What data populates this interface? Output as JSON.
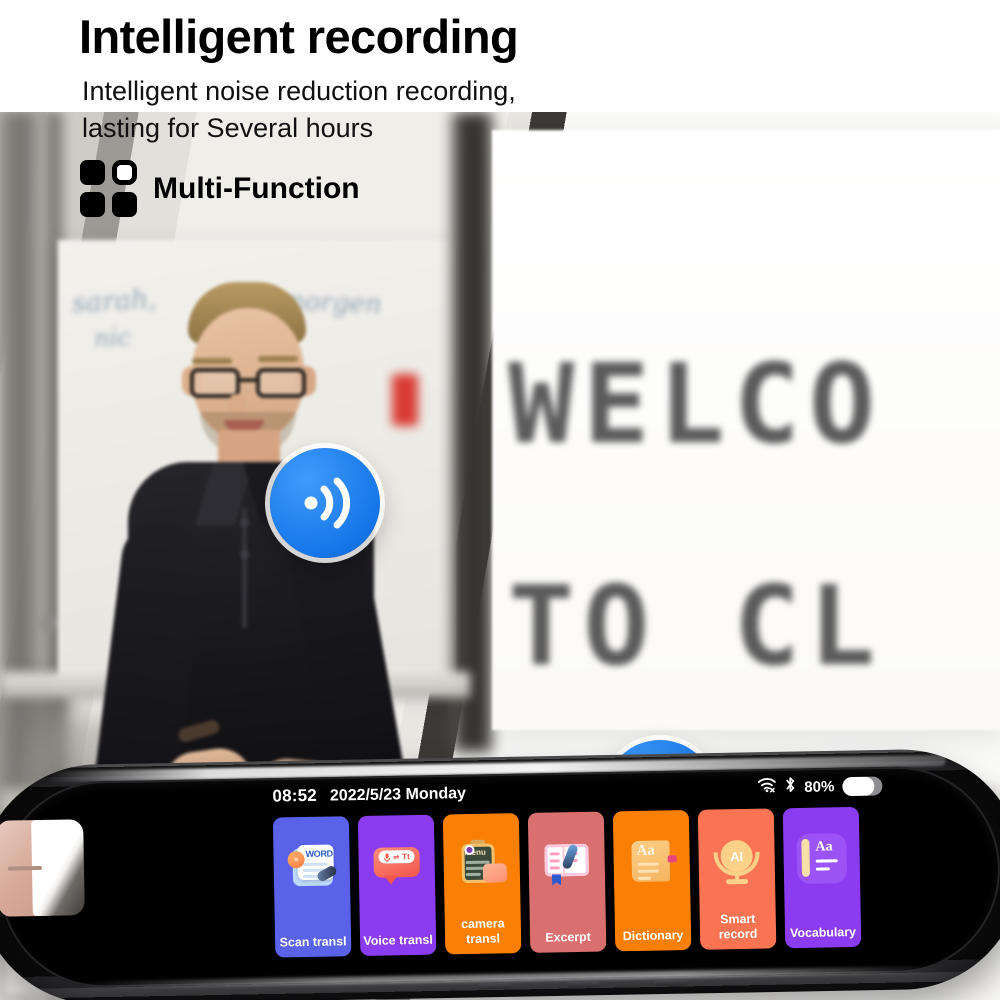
{
  "header": {
    "title": "Intelligent recording",
    "subtitle_line1": "Intelligent noise reduction recording,",
    "subtitle_line2": "lasting for Several hours",
    "feature_label": "Multi-Function",
    "feature_icon": "grid-2x2-icon"
  },
  "scene": {
    "whiteboard_notes": [
      "sarah,",
      "nic",
      "morgen"
    ],
    "projection_line1": "WELCO",
    "projection_line2": "TO CL",
    "badges": [
      {
        "name": "sound-wave-badge",
        "icon": "sound-wave-icon",
        "color": "#1575e8"
      },
      {
        "name": "microphone-badge",
        "icon": "microphone-icon",
        "color": "#1575e8"
      }
    ]
  },
  "device": {
    "statusbar": {
      "time": "08:52",
      "date": "2022/5/23 Monday",
      "wifi_icon": "wifi-off-icon",
      "bluetooth_icon": "bluetooth-icon",
      "battery_percent": "80%",
      "battery_level": 80,
      "battery_icon": "battery-icon"
    },
    "apps": [
      {
        "label": "Scan transl",
        "icon": "scan-translate-icon",
        "color": "#5a62ea",
        "icon_text": "WORD"
      },
      {
        "label": "Voice transl",
        "icon": "voice-translate-icon",
        "color": "#8b3bf0",
        "icon_text": "Tt"
      },
      {
        "label": "camera transl",
        "icon": "camera-translate-icon",
        "color": "#fa8005",
        "icon_text": "menu"
      },
      {
        "label": "Excerpt",
        "icon": "excerpt-book-icon",
        "color": "#d9706f",
        "icon_text": ""
      },
      {
        "label": "Dictionary",
        "icon": "dictionary-icon",
        "color": "#fa8005",
        "icon_text": "Aa"
      },
      {
        "label": "Smart record",
        "icon": "smart-record-ai-icon",
        "color": "#fa7454",
        "icon_text": "AI"
      },
      {
        "label": "Vocabulary",
        "icon": "vocabulary-icon",
        "color": "#8b3bf0",
        "icon_text": "Aa"
      }
    ],
    "scanner_tip": "scanner-tip"
  }
}
